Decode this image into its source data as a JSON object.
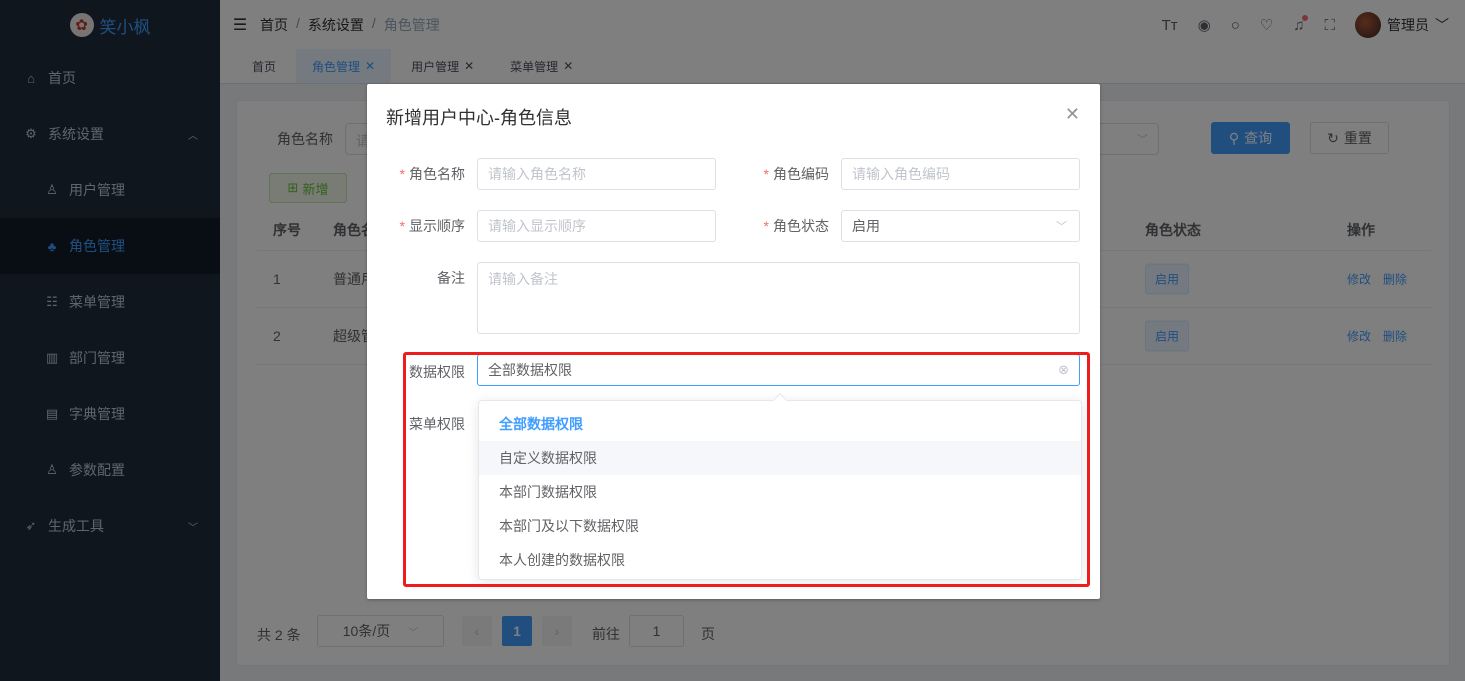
{
  "app": {
    "logo_text": "笑小枫"
  },
  "sidebar": {
    "items": [
      {
        "label": "首页",
        "icon": "home-icon"
      },
      {
        "label": "系统设置",
        "icon": "gear-icon"
      },
      {
        "label": "用户管理",
        "icon": "user-icon"
      },
      {
        "label": "角色管理",
        "icon": "role-icon"
      },
      {
        "label": "菜单管理",
        "icon": "tree-icon"
      },
      {
        "label": "部门管理",
        "icon": "dept-icon"
      },
      {
        "label": "字典管理",
        "icon": "dict-icon"
      },
      {
        "label": "参数配置",
        "icon": "param-icon"
      },
      {
        "label": "生成工具",
        "icon": "rocket-icon"
      }
    ]
  },
  "header": {
    "breadcrumb": [
      "首页",
      "系统设置",
      "角色管理"
    ],
    "user_name": "管理员"
  },
  "tags": [
    "首页",
    "角色管理",
    "用户管理",
    "菜单管理"
  ],
  "search": {
    "label": "角色名称",
    "placeholder": "请",
    "query_label": "查询",
    "reset_label": "重置"
  },
  "toolbar": {
    "add_label": "新增"
  },
  "table": {
    "headers": [
      "序号",
      "角色名",
      "角色状态",
      "操作"
    ],
    "rows": [
      {
        "index": "1",
        "name": "普通用",
        "status": "启用",
        "edit": "修改",
        "delete": "删除"
      },
      {
        "index": "2",
        "name": "超级管",
        "status": "启用",
        "edit": "修改",
        "delete": "删除"
      }
    ]
  },
  "pagination": {
    "total": "共 2 条",
    "page_size": "10条/页",
    "current_page": "1",
    "goto_label": "前往",
    "goto_value": "1",
    "page_suffix": "页"
  },
  "dialog": {
    "title": "新增用户中心-角色信息",
    "fields": {
      "role_name": {
        "label": "角色名称",
        "placeholder": "请输入角色名称"
      },
      "role_code": {
        "label": "角色编码",
        "placeholder": "请输入角色编码"
      },
      "display_order": {
        "label": "显示顺序",
        "placeholder": "请输入显示顺序"
      },
      "role_status": {
        "label": "角色状态",
        "value": "启用"
      },
      "remark": {
        "label": "备注",
        "placeholder": "请输入备注"
      },
      "data_scope": {
        "label": "数据权限",
        "value": "全部数据权限"
      },
      "menu_perm": {
        "label": "菜单权限"
      }
    },
    "data_scope_options": [
      "全部数据权限",
      "自定义数据权限",
      "本部门数据权限",
      "本部门及以下数据权限",
      "本人创建的数据权限"
    ]
  },
  "colors": {
    "accent": "#409eff",
    "sidebar_bg": "#1f2d3d",
    "highlight": "#ee1c1c",
    "success": "#67c23a"
  }
}
